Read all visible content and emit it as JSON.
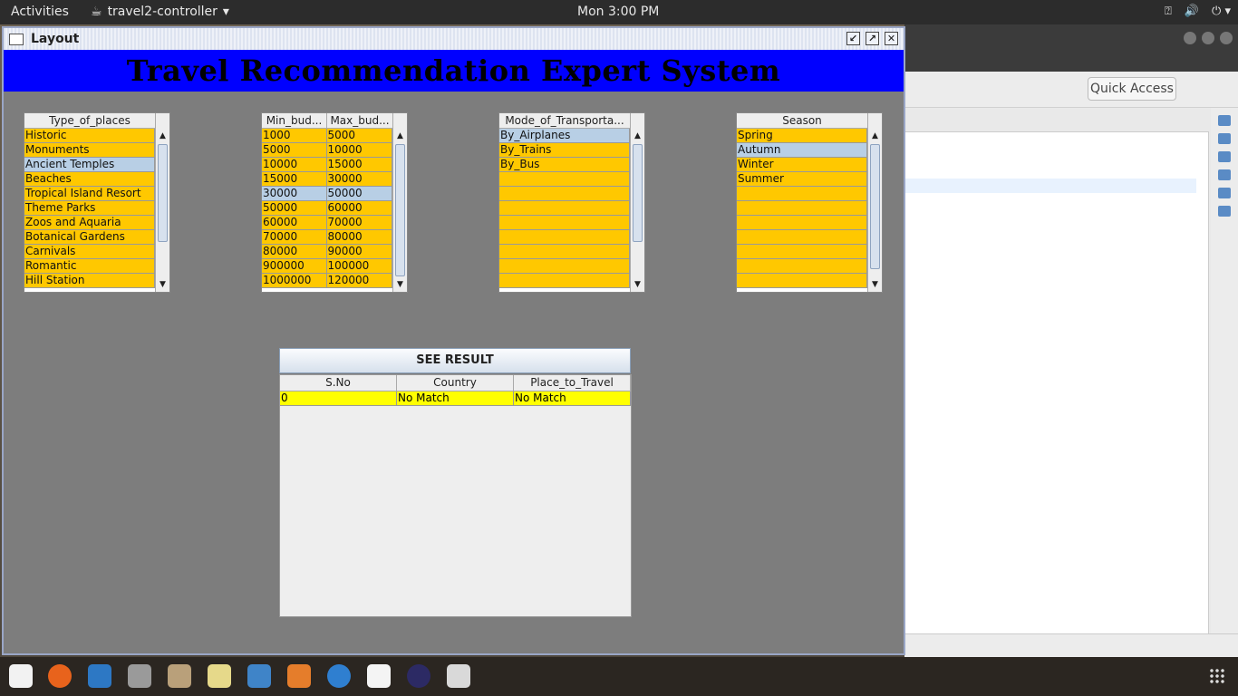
{
  "topbar": {
    "activities": "Activities",
    "app_name": "travel2-controller",
    "clock": "Mon  3:00 PM"
  },
  "eclipse": {
    "quick_access": "Quick Access"
  },
  "dialog": {
    "title": "Layout",
    "banner": "Travel Recommendation Expert System",
    "see_result": "SEE RESULT"
  },
  "type_of_places": {
    "header": "Type_of_places",
    "items": [
      "Historic",
      "Monuments",
      "Ancient Temples",
      "Beaches",
      "Tropical Island Resort",
      "Theme Parks",
      "Zoos and Aquaria",
      "Botanical Gardens",
      "Carnivals",
      "Romantic",
      "Hill Station"
    ],
    "selected_index": 2
  },
  "budget": {
    "header_min": "Min_bud...",
    "header_max": "Max_bud...",
    "rows": [
      [
        "1000",
        "5000"
      ],
      [
        "5000",
        "10000"
      ],
      [
        "10000",
        "15000"
      ],
      [
        "15000",
        "30000"
      ],
      [
        "30000",
        "50000"
      ],
      [
        "50000",
        "60000"
      ],
      [
        "60000",
        "70000"
      ],
      [
        "70000",
        "80000"
      ],
      [
        "80000",
        "90000"
      ],
      [
        "900000",
        "100000"
      ],
      [
        "1000000",
        "120000"
      ]
    ],
    "selected_index": 4
  },
  "transport": {
    "header": "Mode_of_Transporta...",
    "items": [
      "By_Airplanes",
      "By_Trains",
      "By_Bus",
      "",
      "",
      "",
      "",
      "",
      "",
      "",
      ""
    ],
    "selected_index": 0
  },
  "season": {
    "header": "Season",
    "items": [
      "Spring",
      "Autumn",
      "Winter",
      "Summer",
      "",
      "",
      "",
      "",
      "",
      "",
      ""
    ],
    "selected_index": 1
  },
  "result": {
    "headers": [
      "S.No",
      "Country",
      "Place_to_Travel"
    ],
    "rows": [
      [
        "0",
        "No Match",
        "No Match"
      ]
    ]
  },
  "colors": {
    "banner_bg": "#0000ff",
    "list_cell": "#ffc800",
    "list_selected": "#b8cfe5",
    "result_cell": "#ffff00"
  }
}
